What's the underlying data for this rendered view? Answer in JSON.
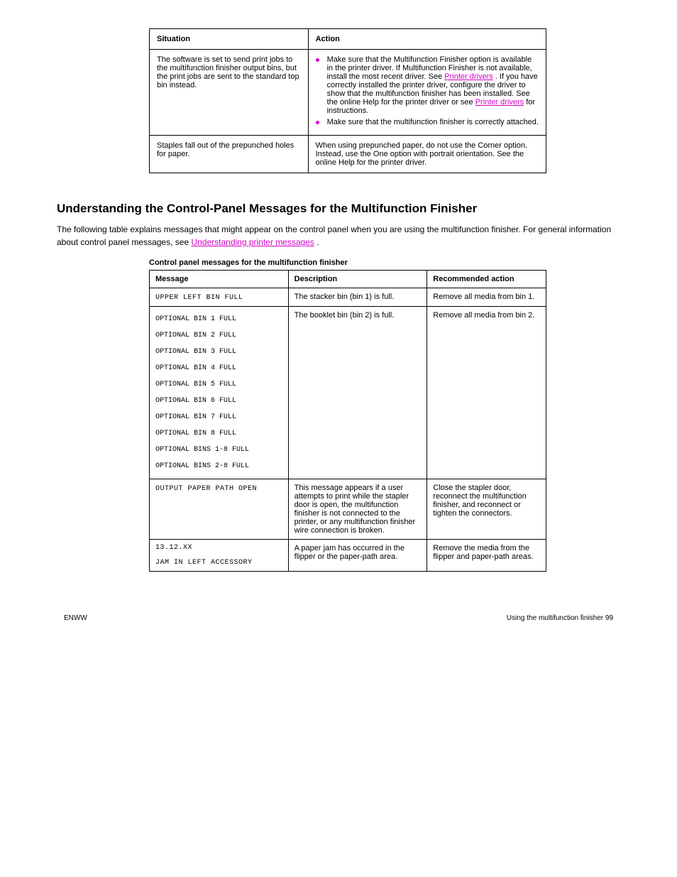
{
  "table1": {
    "header": {
      "c1": "Situation",
      "c2": "Action"
    },
    "rows": [
      {
        "situation": "The software is set to send print jobs to the multifunction finisher output bins, but the print jobs are sent to the standard top bin instead.",
        "action_bullet1_text": "Make sure that the Multifunction Finisher option is available in the printer driver. If Multifunction Finisher is not available, install the most recent driver. See ",
        "action_link1": "Printer drivers",
        "action_bullet1_tail": ". If you have correctly installed the printer driver, configure the driver to show that the multifunction finisher has been installed. See the online Help for the printer driver or see ",
        "action_link2": "Printer drivers",
        "action_bullet1_tail2": " for instructions.",
        "action_bullet2_text": "Make sure that the multifunction finisher is correctly attached."
      },
      {
        "situation": "Staples fall out of the prepunched holes for paper.",
        "action_text": "When using prepunched paper, do not use the Corner option. Instead, use the One option with portrait orientation. See the online Help for the printer driver."
      }
    ]
  },
  "heading": "Understanding the Control-Panel Messages for the Multifunction Finisher",
  "para_text": "The following table explains messages that might appear on the control panel when you are using the multifunction finisher. For general information about control panel messages, see ",
  "para_link": "Understanding printer messages",
  "para_tail": ".",
  "table2": {
    "caption": "Control panel messages for the multifunction finisher",
    "header": {
      "c1": "Message",
      "c2": "Description",
      "c3": "Recommended action"
    },
    "rows": [
      {
        "msg_mono": "UPPER LEFT BIN FULL",
        "desc": "The stacker bin (bin 1) is full.",
        "act": "Remove all media from bin 1."
      },
      {
        "msg_block": "OPTIONAL BIN 1 FULL\nOPTIONAL BIN 2 FULL\nOPTIONAL BIN 3 FULL\nOPTIONAL BIN 4 FULL\nOPTIONAL BIN 5 FULL\nOPTIONAL BIN 6 FULL\nOPTIONAL BIN 7 FULL\nOPTIONAL BIN 8 FULL\nOPTIONAL BINS 1-8 FULL\nOPTIONAL BINS 2-8 FULL",
        "desc": "The booklet bin (bin 2) is full.",
        "act": "Remove all media from bin 2."
      },
      {
        "msg_mono": "OUTPUT PAPER PATH OPEN",
        "desc": "This message appears if a user attempts to print while the stapler door is open, the multifunction finisher is not connected to the printer, or any multifunction finisher wire connection is broken.",
        "act": "Close the stapler door, reconnect the multifunction finisher, and reconnect or tighten the connectors."
      },
      {
        "msg_line1": "13.12.XX",
        "msg_line2": "JAM IN LEFT ACCESSORY",
        "desc": "A paper jam has occurred in the flipper or the paper-path area.",
        "act": "Remove the media from the flipper and paper-path areas."
      }
    ]
  },
  "footer": {
    "left": "ENWW",
    "right": "Using the multifunction finisher  99"
  }
}
